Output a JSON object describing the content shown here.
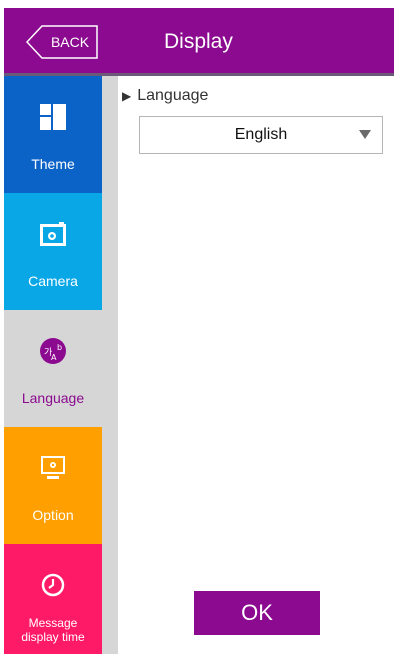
{
  "header": {
    "back_label": "BACK",
    "title": "Display",
    "color": "#8b0a8f"
  },
  "sidebar": {
    "items": [
      {
        "label": "Theme",
        "icon": "theme-grid-icon",
        "color": "#0b63c7",
        "selected": false
      },
      {
        "label": "Camera",
        "icon": "camera-icon",
        "color": "#0aa7e6",
        "selected": false
      },
      {
        "label": "Language",
        "icon": "language-icon",
        "color": "#d6d6d6",
        "selected": true
      },
      {
        "label": "Option",
        "icon": "option-monitor-icon",
        "color": "#ff9f00",
        "selected": false
      },
      {
        "label": "Message display time",
        "label_line1": "Message",
        "label_line2": "display time",
        "icon": "clock-icon",
        "color": "#ff1a67",
        "selected": false
      }
    ]
  },
  "main": {
    "section_label": "Language",
    "language_select": {
      "value": "English"
    },
    "ok_label": "OK"
  }
}
